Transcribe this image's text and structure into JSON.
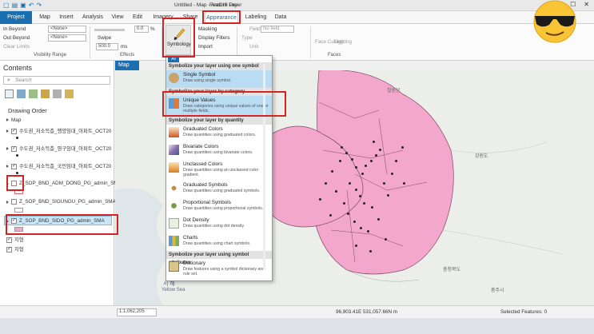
{
  "title_bar": {
    "document": "Untitled - Map - ArcGIS Pro",
    "contextual": "Feature Layer"
  },
  "tabs": [
    {
      "label": "Project"
    },
    {
      "label": "Map"
    },
    {
      "label": "Insert"
    },
    {
      "label": "Analysis"
    },
    {
      "label": "View"
    },
    {
      "label": "Edit"
    },
    {
      "label": "Imagery"
    },
    {
      "label": "Share"
    },
    {
      "label": "Appearance"
    },
    {
      "label": "Labeling"
    },
    {
      "label": "Data"
    }
  ],
  "ribbon": {
    "in_beyond": "In Beyond",
    "out_beyond": "Out Beyond",
    "clear_limits": "Clear Limits",
    "none1": "<None>",
    "none2": "<None>",
    "visibility_range": "Visibility Range",
    "transparency": "0.0",
    "pct": "%",
    "swipe": "Swipe",
    "flicker": "500.0",
    "ms": "ms",
    "effects": "Effects",
    "symbology": "Symbology",
    "masking": "Masking",
    "display_filters": "Display Filters",
    "import": "Import",
    "field_label": "Field",
    "field_value": "No field",
    "type_label": "Type",
    "unit_label": "Unit",
    "face_culling": "Face Culling",
    "lighting": "Lighting",
    "faces": "Faces"
  },
  "contents": {
    "title": "Contents",
    "search_placeholder": "Search",
    "drawing_order": "Drawing Order",
    "map": "Map",
    "layers": [
      {
        "name": "수도권_저소득층_행양임대_아파트_OCT20"
      },
      {
        "name": "수도권_저소득층_영구임대_아파트_OCT20"
      },
      {
        "name": "수도권_저소득층_국민임대_아파트_OCT20"
      },
      {
        "name": "Z_SOP_BND_ADM_DONG_PG_admin_SMA"
      },
      {
        "name": "Z_SOP_BND_SIGUNGU_PG_admin_SMA"
      },
      {
        "name": "Z_SOP_BND_SIDO_PG_admin_SMA"
      },
      {
        "name": "지형"
      },
      {
        "name": "지형"
      }
    ]
  },
  "map_tab": "Map",
  "menu": {
    "all": "All",
    "sections": [
      "Symbolize your layer using one symbol",
      "Symbolize your layer by category",
      "Symbolize your layer by quantity",
      "Symbolize your layer using symbol attributes"
    ],
    "items": [
      {
        "title": "Single Symbol",
        "desc": "Draw using single symbol."
      },
      {
        "title": "Unique Values",
        "desc": "Draw categories using unique values of one or multiple fields."
      },
      {
        "title": "Graduated Colors",
        "desc": "Draw quantities using graduated colors."
      },
      {
        "title": "Bivariate Colors",
        "desc": "Draw quantities using bivariate colors."
      },
      {
        "title": "Unclassed Colors",
        "desc": "Draw quantities using an unclassed color gradient."
      },
      {
        "title": "Graduated Symbols",
        "desc": "Draw quantities using graduated symbols."
      },
      {
        "title": "Proportional Symbols",
        "desc": "Draw quantities using proportional symbols."
      },
      {
        "title": "Dot Density",
        "desc": "Draw quantities using dot density."
      },
      {
        "title": "Charts",
        "desc": "Draw quantities using chart symbols."
      },
      {
        "title": "Dictionary",
        "desc": "Draw features using a symbol dictionary and rule set."
      }
    ]
  },
  "map_labels": {
    "west_sea": "서 해",
    "yellow_sea": "Yellow Sea",
    "gangwon": "강원도",
    "chungbuk": "충청북도",
    "cheorwon": "철원군",
    "chungju": "충주시"
  },
  "status": {
    "scale": "1:1,062,205",
    "coords": "96,903.41E 531,057.66N m",
    "selected": "Selected Features: 0"
  },
  "colors": {
    "accent": "#1a6fb0",
    "polygon": "#f4a7cc",
    "highlight": "#d32424",
    "selection": "#b9dcf3"
  }
}
